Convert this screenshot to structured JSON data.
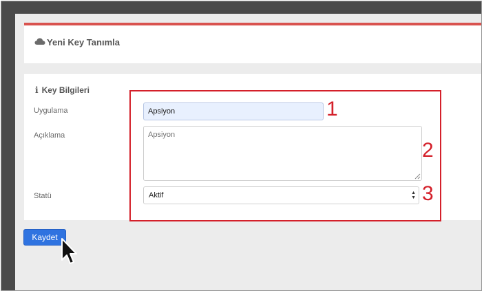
{
  "header": {
    "title": "Yeni Key Tanımla",
    "icon": "cloud-icon",
    "accent_color": "#d9534f"
  },
  "form": {
    "section_title": "Key Bilgileri",
    "section_icon": "info-icon",
    "fields": {
      "uygulama": {
        "label": "Uygulama",
        "value": "Apsiyon"
      },
      "aciklama": {
        "label": "Açıklama",
        "placeholder": "Apsiyon"
      },
      "statu": {
        "label": "Statü",
        "selected": "Aktif"
      }
    }
  },
  "actions": {
    "save_label": "Kaydet",
    "save_color": "#2f73e0"
  },
  "annotations": {
    "color": "#d4202a",
    "labels": [
      "1",
      "2",
      "3"
    ]
  }
}
